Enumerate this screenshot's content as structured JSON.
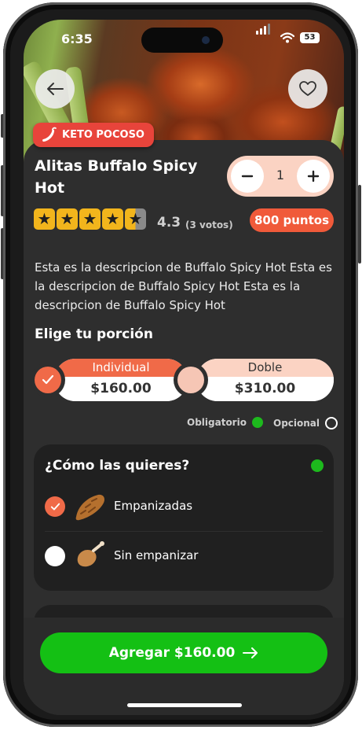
{
  "status_bar": {
    "time": "6:35",
    "battery": "53"
  },
  "product": {
    "badge": "KETO POCOSO",
    "title": "Alitas Buffalo Spicy Hot",
    "quantity": "1",
    "rating": "4.3",
    "votes": "(3 votos)",
    "stars_filled": 4.3,
    "points": "800 puntos",
    "description": "Esta es la descripcion de Buffalo Spicy Hot Esta es la descripcion de Buffalo Spicy Hot Esta es la descripcion de Buffalo Spicy Hot"
  },
  "portion": {
    "title": "Elige tu porción",
    "options": [
      {
        "label": "Individual",
        "price": "$160.00",
        "selected": true
      },
      {
        "label": "Doble",
        "price": "$310.00",
        "selected": false
      }
    ]
  },
  "legend": {
    "required": "Obligatorio",
    "optional": "Opcional"
  },
  "how": {
    "title": "¿Cómo las quieres?",
    "options": [
      {
        "label": "Empanizadas",
        "selected": true
      },
      {
        "label": "Sin empanizar",
        "selected": false
      }
    ]
  },
  "cta": {
    "label": "Agregar $160.00"
  },
  "colors": {
    "accent": "#f06a48",
    "badge": "#e8443b",
    "cta": "#14c014",
    "required_dot": "#1db91d",
    "star": "#f2b51c"
  }
}
